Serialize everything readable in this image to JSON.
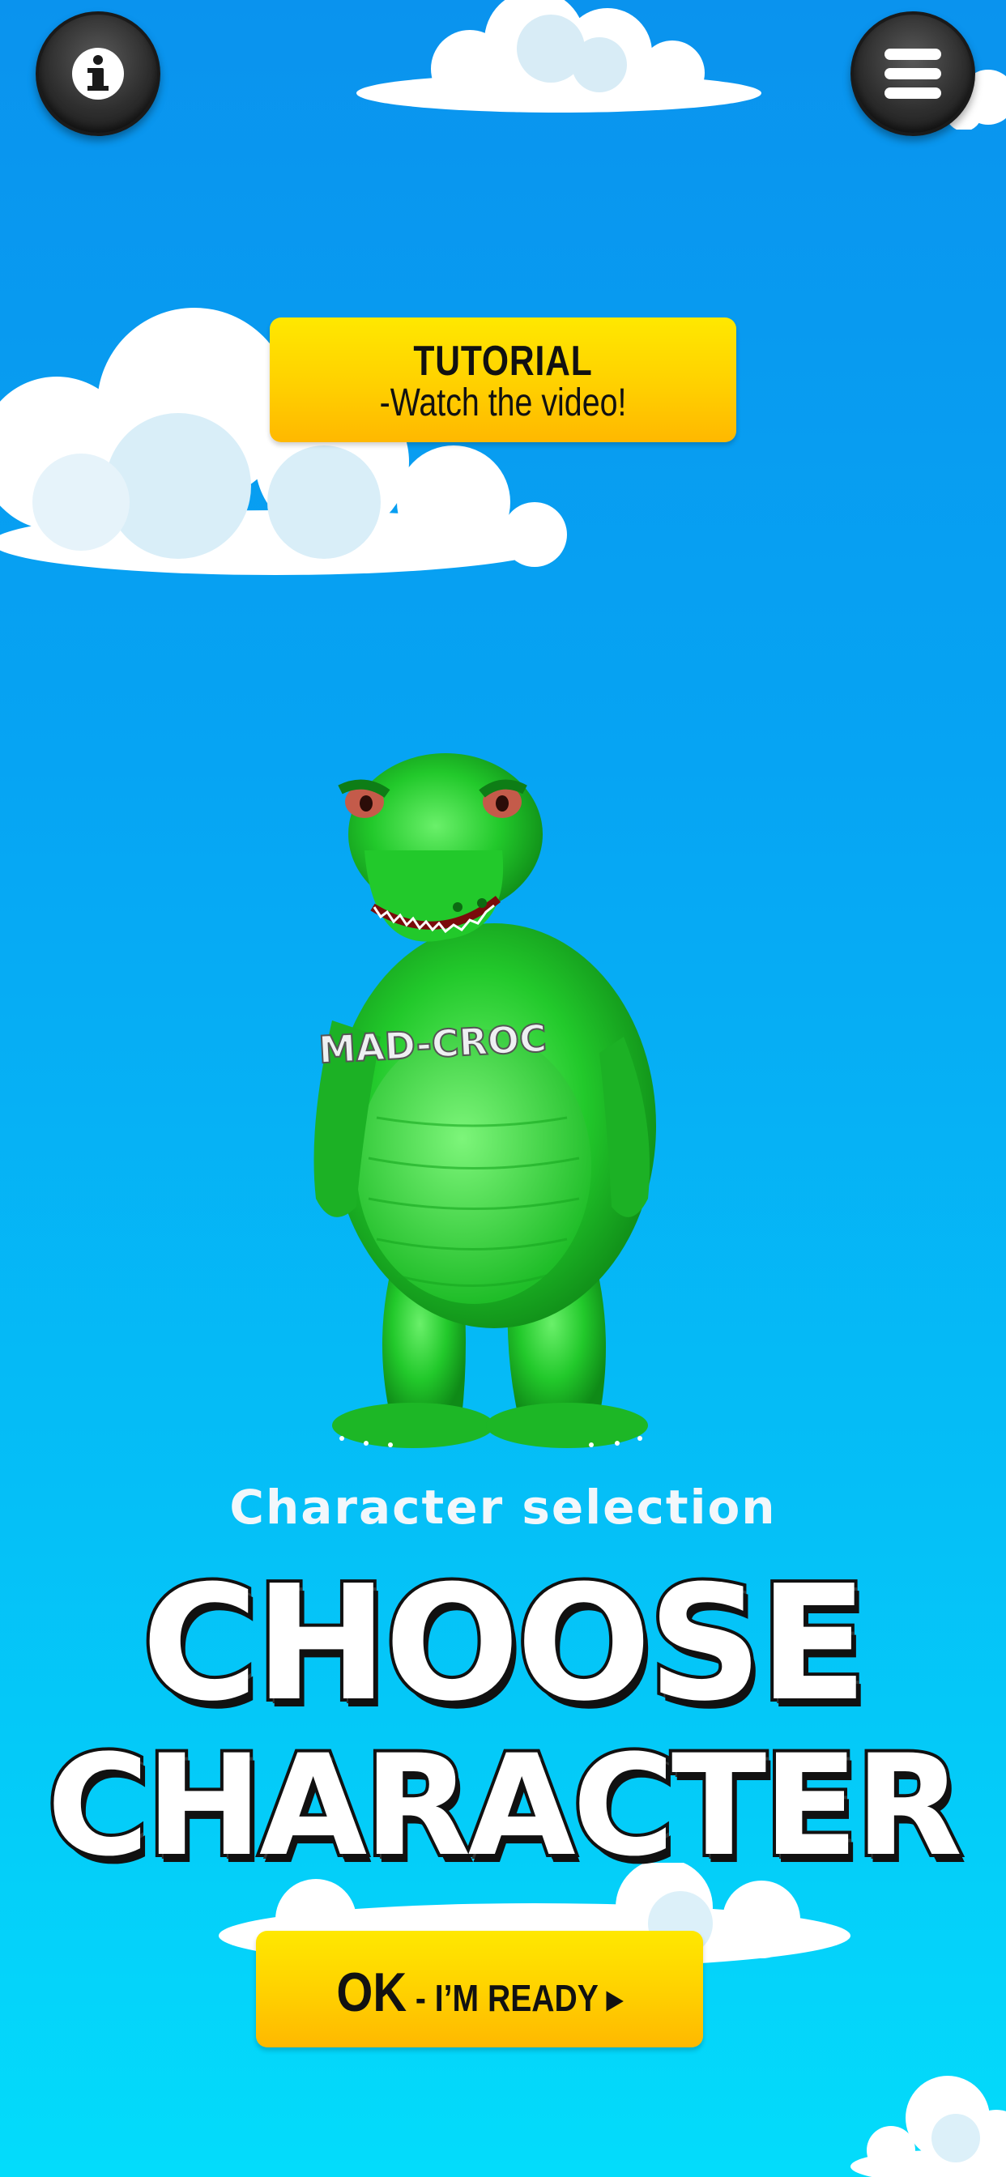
{
  "top_bar": {
    "info_icon": "info-icon",
    "menu_icon": "hamburger-menu-icon"
  },
  "tutorial": {
    "title": "TUTORIAL",
    "subtitle": "-Watch the video!"
  },
  "character": {
    "shirt_text": "MAD-CROC"
  },
  "selection": {
    "subtitle": "Character selection",
    "title_line_1": "CHOOSE",
    "title_line_2": "CHARACTER"
  },
  "ok_button": {
    "main": "OK",
    "rest": " - I’M READY ▸"
  },
  "colors": {
    "sky_top": "#0a93ee",
    "sky_bottom": "#03dcfb",
    "button_yellow": "#ffd000",
    "croc_green": "#1fc52a"
  }
}
